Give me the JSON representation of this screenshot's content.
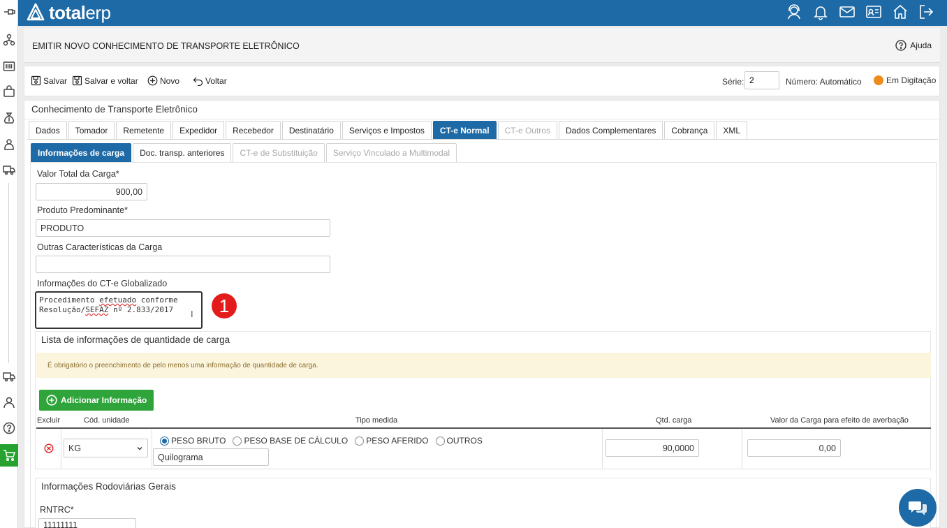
{
  "app": {
    "logo_text_bold": "total",
    "logo_text_light": "erp"
  },
  "header": {
    "title": "EMITIR NOVO CONHECIMENTO DE TRANSPORTE ELETRÔNICO",
    "help_label": "Ajuda"
  },
  "toolbar": {
    "save_label": "Salvar",
    "save_back_label": "Salvar e voltar",
    "new_label": "Novo",
    "back_label": "Voltar",
    "serie_label": "Série:",
    "serie_value": "2",
    "numero_label": "Número: Automático",
    "status_label": "Em Digitação",
    "status_color": "#ee8b1c"
  },
  "card": {
    "title": "Conhecimento de Transporte Eletrônico"
  },
  "tabs": [
    {
      "label": "Dados",
      "state": "normal"
    },
    {
      "label": "Tomador",
      "state": "normal"
    },
    {
      "label": "Remetente",
      "state": "normal"
    },
    {
      "label": "Expedidor",
      "state": "normal"
    },
    {
      "label": "Recebedor",
      "state": "normal"
    },
    {
      "label": "Destinatário",
      "state": "normal"
    },
    {
      "label": "Serviços e Impostos",
      "state": "normal"
    },
    {
      "label": "CT-e Normal",
      "state": "active"
    },
    {
      "label": "CT-e Outros",
      "state": "disabled"
    },
    {
      "label": "Dados Complementares",
      "state": "normal"
    },
    {
      "label": "Cobrança",
      "state": "normal"
    },
    {
      "label": "XML",
      "state": "normal"
    }
  ],
  "subtabs": [
    {
      "label": "Informações de carga",
      "state": "active"
    },
    {
      "label": "Doc. transp. anteriores",
      "state": "normal"
    },
    {
      "label": "CT-e de Substituição",
      "state": "disabled"
    },
    {
      "label": "Serviço Vinculado a Multimodal",
      "state": "disabled"
    }
  ],
  "form": {
    "valor_total_label": "Valor Total da Carga*",
    "valor_total_value": "900,00",
    "produto_label": "Produto Predominante*",
    "produto_value": "PRODUTO",
    "outras_label": "Outras Características da Carga",
    "outras_value": "",
    "globalizado_label": "Informações do CT-e Globalizado",
    "globalizado_line1_a": "Procedimento ",
    "globalizado_line1_b": "efetuado",
    "globalizado_line1_c": " conforme",
    "globalizado_line2_a": "Resolução/",
    "globalizado_line2_b": "SEFAZ",
    "globalizado_line2_c": " nº 2.833/2017",
    "marker_number": "1"
  },
  "qty_section": {
    "title": "Lista de informações de quantidade de carga",
    "alert": "É obrigatório o preenchimento de pelo menos uma informação de quantidade de carga.",
    "add_button": "Adicionar Informação",
    "columns": {
      "excluir": "Excluir",
      "cod_unidade": "Cód. unidade",
      "tipo_medida": "Tipo medida",
      "qtd_carga": "Qtd. carga",
      "valor_carga": "Valor da Carga para efeito de averbação"
    },
    "row": {
      "unidade": "KG",
      "radios": [
        {
          "label": "PESO BRUTO",
          "selected": true
        },
        {
          "label": "PESO BASE DE CÁLCULO",
          "selected": false
        },
        {
          "label": "PESO AFERIDO",
          "selected": false
        },
        {
          "label": "OUTROS",
          "selected": false
        }
      ],
      "descricao": "Quilograma",
      "qtd": "90,0000",
      "valor": "0,00"
    }
  },
  "rodo_section": {
    "title": "Informações Rodoviárias Gerais",
    "rntrc_label": "RNTRC*",
    "rntrc_value": "11111111"
  },
  "colors": {
    "brand": "#1e6aa7",
    "success": "#2fa43a",
    "alert_bg": "#fcf5de",
    "danger": "#e41b1b"
  }
}
